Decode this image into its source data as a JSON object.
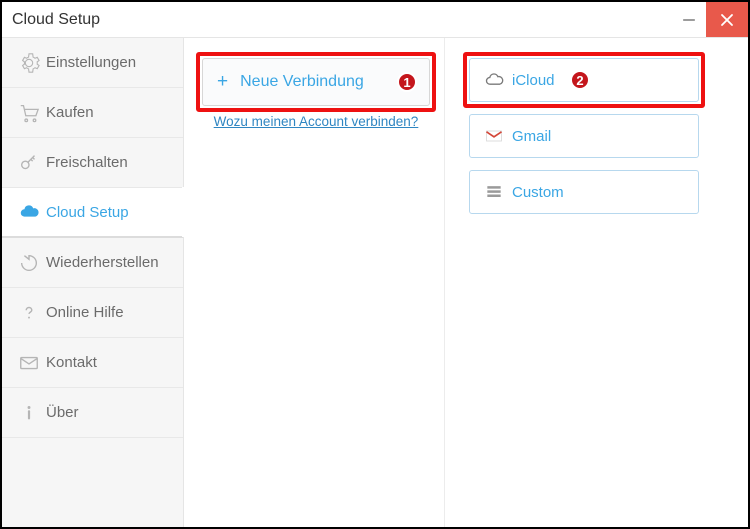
{
  "window": {
    "title": "Cloud Setup"
  },
  "sidebar": {
    "items": [
      {
        "label": "Einstellungen"
      },
      {
        "label": "Kaufen"
      },
      {
        "label": "Freischalten"
      },
      {
        "label": "Cloud Setup"
      },
      {
        "label": "Wiederherstellen"
      },
      {
        "label": "Online Hilfe"
      },
      {
        "label": "Kontakt"
      },
      {
        "label": "Über"
      }
    ],
    "active_index": 3
  },
  "main": {
    "new_connection_label": "Neue Verbindung",
    "help_link_label": "Wozu meinen Account verbinden?"
  },
  "providers": {
    "items": [
      {
        "label": "iCloud"
      },
      {
        "label": "Gmail"
      },
      {
        "label": "Custom"
      }
    ]
  },
  "callouts": {
    "badge1": "1",
    "badge2": "2"
  }
}
